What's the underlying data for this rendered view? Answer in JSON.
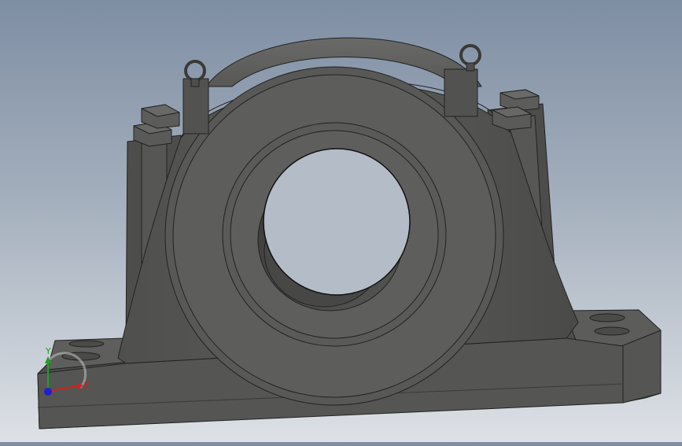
{
  "viewport": {
    "model": "plummer-block-bearing-housing",
    "background_top": "#7e8ea3",
    "background_bottom": "#dde1e6",
    "body_color": "#5a5a58"
  },
  "triad": {
    "x_label": "X",
    "y_label": "Y",
    "x_color": "#d42020",
    "y_color": "#1fa21f",
    "z_color": "#2020d0"
  }
}
